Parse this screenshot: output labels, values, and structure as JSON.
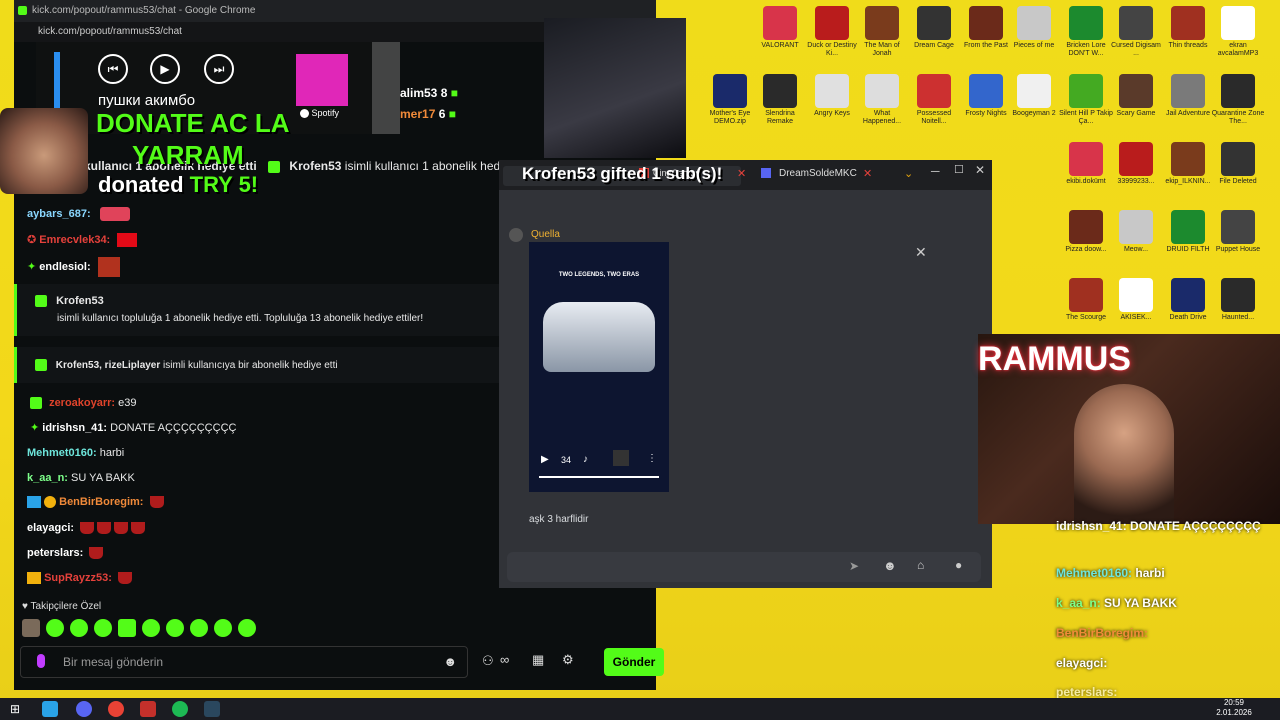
{
  "window": {
    "title": "kick.com/popout/rammus53/chat - Google Chrome",
    "url": "kick.com/popout/rammus53/chat"
  },
  "spotify": {
    "track": "пушки акимбо",
    "brand": "Spotify"
  },
  "alert": {
    "line1": "DONATE AC LA",
    "line2": "YARRAM",
    "line3_prefix": "donated ",
    "line3_amount": "TRY 5!"
  },
  "gift_alert": {
    "text": "Krofen53 gifted 1 sub(s)!"
  },
  "top_users": [
    {
      "name": "alim53",
      "count": "8"
    },
    {
      "name": "mer17",
      "count": "6"
    }
  ],
  "system_line": {
    "prefix": "kullanıcı 1 abonelik hediye etti",
    "user": "Krofen53",
    "suffix": "isimli kullanıcı 1 abonelik hediye"
  },
  "chat": {
    "messages_top": [
      {
        "user": "aybars_687:",
        "text": ""
      },
      {
        "user": "Emrecvlek34:",
        "text": ""
      },
      {
        "user": "endlesiol:",
        "text": ""
      }
    ],
    "gift1": {
      "user": "Krofen53",
      "text": "isimli kullanıcı topluluğa 1 abonelik hediye etti. Topluluğa 13 abonelik hediye ettiler!"
    },
    "gift2": {
      "users": "Krofen53, rizeLiplayer",
      "text": "isimli kullanıcıya bir abonelik hediye etti"
    },
    "messages": [
      {
        "user": "zeroakoyarr:",
        "text": "e39"
      },
      {
        "user": "idrishsn_41:",
        "text": "DONATE AÇÇÇÇÇÇÇÇÇ"
      },
      {
        "user": "Mehmet0160:",
        "text": "harbi"
      },
      {
        "user": "k_aa_n:",
        "text": "SU YA BAKK"
      },
      {
        "user": "BenBirBoregim:",
        "text": ""
      },
      {
        "user": "elayagci:",
        "text": ""
      },
      {
        "user": "peterslars:",
        "text": ""
      },
      {
        "user": "SupRayzz53:",
        "text": ""
      }
    ],
    "followers_label": "Takipçilere Özel",
    "input_placeholder": "Bir mesaj gönderin",
    "send_label": "Gönder"
  },
  "discord": {
    "tab1": "CinoOsman",
    "tab2": "DreamSoldeMKC",
    "author": "Quella",
    "video_caption_title": "TWO LEGENDS, TWO ERAS",
    "video_time": "34",
    "message": "aşk 3 harflidir"
  },
  "overlay_chat": [
    {
      "user": "idrishsn_41:",
      "text": "DONATE AÇÇÇÇÇÇÇÇ"
    },
    {
      "user": "Mehmet0160:",
      "text": "harbi"
    },
    {
      "user": "k_aa_n:",
      "text": "SU YA BAKK"
    },
    {
      "user": "BenBirBoregim:",
      "text": ""
    },
    {
      "user": "elayagci:",
      "text": ""
    },
    {
      "user": "peterslars:",
      "text": ""
    }
  ],
  "cam_sign": "RAMMUS",
  "desktop_icons": [
    "VALORANT",
    "Duck or Destiny Ki...",
    "The Man of Jonah",
    "Dream Cage",
    "From the Past",
    "Pieces of me",
    "Bricken Lore DON'T W...",
    "Cursed Digisam ...",
    "Thin threads",
    "ekran avcalamMP3",
    "Mother's Eye DEMO.zip",
    "Slendrina Remake",
    "Angry Keys",
    "What Happened...",
    "Possessed Noitell...",
    "Frosty Nights",
    "Boogeyman 2",
    "Silent Hill P Takip Ça...",
    "Scary Game",
    "Jail Adventure",
    "Quarantine Zone The...",
    "ekibi.dokümt",
    "33999233...",
    "ekip_ILKNIN...",
    "File Deleted",
    "Pizza doow...",
    "Meow...",
    "DRUID FILTH",
    "Puppet House",
    "The Scourge",
    "AKISEK...",
    "Death Drive",
    "Haunted..."
  ],
  "clock": {
    "time": "20:59",
    "date": "2.01.2026"
  }
}
